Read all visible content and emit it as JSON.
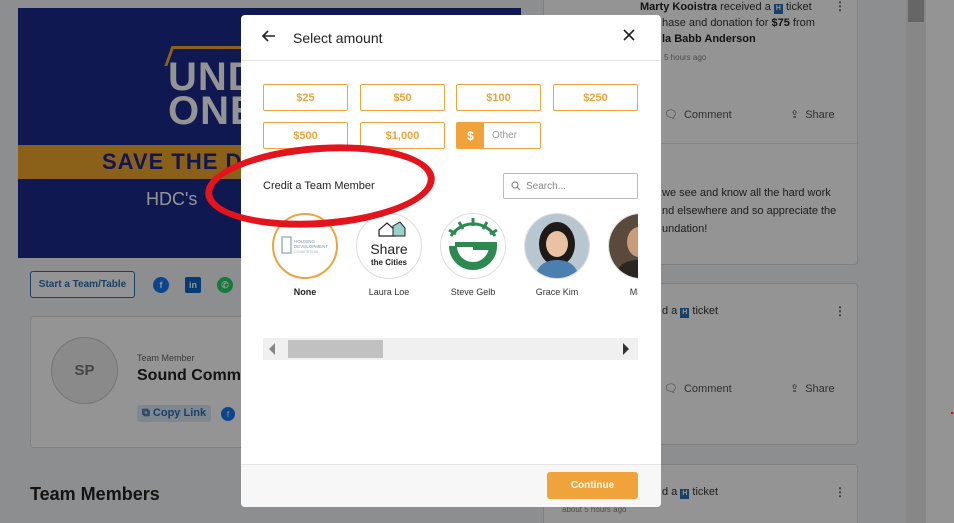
{
  "background": {
    "banner": {
      "title_line1": "UND",
      "title_line2": "ONE",
      "save_text": "SAVE THE D",
      "subtitle": "HDC's"
    },
    "start_team_label": "Start a Team/Table",
    "member_card": {
      "initials": "SP",
      "role": "Team Member",
      "name": "Sound Comm",
      "copy_link_label": "Copy Link"
    },
    "team_members_heading": "Team Members",
    "feed": {
      "post1_line1_name": "Marty Kooistra",
      "post1_line1_rest": "received a",
      "post1_line1_end": "ticket",
      "post1_line2_pre": "hase and donation for",
      "post1_amount": "$75",
      "post1_line2_post": "from",
      "post1_line3": "la Babb Anderson",
      "post1_time": "5 hours ago",
      "comment_label": "Comment",
      "share_label": "Share",
      "para_line1": "we see and know all the hard work",
      "para_line2": "nd elsewhere and so appreciate the",
      "para_line3": "undation!",
      "post2_text": "d a",
      "post2_end": "ticket",
      "post3_text": "d a",
      "post3_end": "ticket",
      "post3_time": "about 5 hours ago"
    }
  },
  "modal": {
    "title": "Select amount",
    "amounts": [
      "$25",
      "$50",
      "$100",
      "$250",
      "$500",
      "$1,000"
    ],
    "other_symbol": "$",
    "other_placeholder": "Other",
    "credit_label": "Credit a Team Member",
    "search_placeholder": "Search...",
    "members": [
      {
        "name": "None",
        "selected": true,
        "logo_text": "HOUSING DEVELOPMENT CONSORTIUM"
      },
      {
        "name": "Laura Loe",
        "selected": false,
        "logo_text_1": "Share",
        "logo_text_2": "the Cities"
      },
      {
        "name": "Steve Gelb",
        "selected": false
      },
      {
        "name": "Grace Kim",
        "selected": false
      },
      {
        "name": "Marty",
        "selected": false
      }
    ],
    "continue_label": "Continue"
  },
  "colors": {
    "accent": "#f0a33a",
    "link": "#2f6fb4",
    "annotation": "#e3141b"
  }
}
